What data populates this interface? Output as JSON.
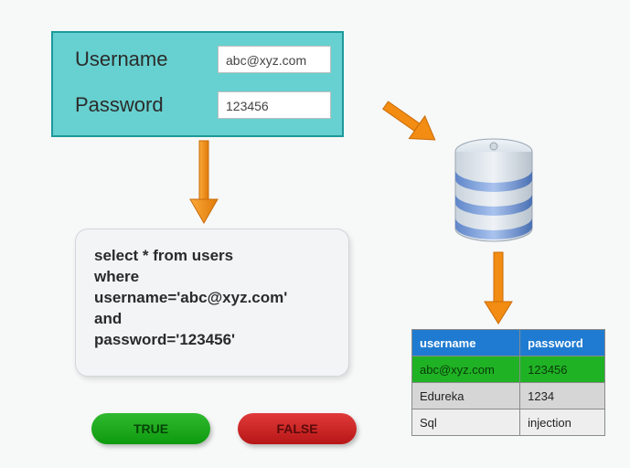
{
  "login": {
    "username_label": "Username",
    "password_label": "Password",
    "username_value": "abc@xyz.com",
    "password_value": "123456"
  },
  "query": {
    "line1": "select * from users",
    "line2": "where",
    "line3": "username='abc@xyz.com'",
    "line4": "and",
    "line5": "password='123456'"
  },
  "buttons": {
    "true_label": "TRUE",
    "false_label": "FALSE"
  },
  "table": {
    "headers": {
      "c1": "username",
      "c2": "password"
    },
    "rows": [
      {
        "c1": "abc@xyz.com",
        "c2": "123456"
      },
      {
        "c1": "Edureka",
        "c2": "1234"
      },
      {
        "c1": "Sql",
        "c2": "injection"
      }
    ]
  },
  "colors": {
    "accent_teal": "#67d0d0",
    "arrow": "#f28c12",
    "table_header": "#1f7bd1",
    "row_match": "#20b225"
  }
}
